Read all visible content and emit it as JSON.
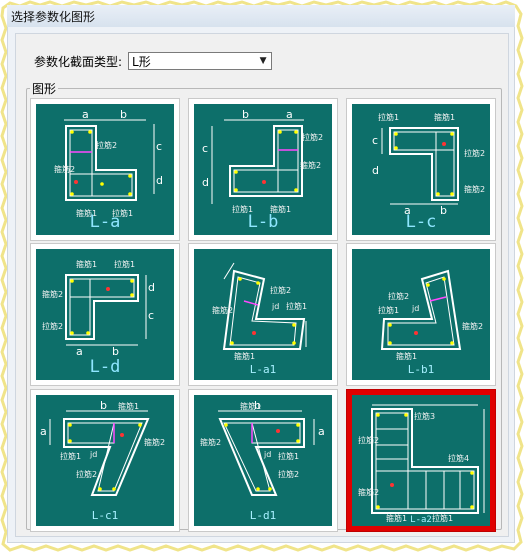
{
  "window": {
    "title": "选择参数化图形"
  },
  "section": {
    "type_label": "参数化截面类型:",
    "type_value": "L形",
    "group_label": "图形"
  },
  "tiles": [
    {
      "caption": "L-a",
      "labels": [
        "a",
        "b",
        "c",
        "d",
        "拉筋2",
        "拉筋1",
        "箍筋2",
        "箍筋1"
      ]
    },
    {
      "caption": "L-b",
      "labels": [
        "b",
        "a",
        "c",
        "d",
        "拉筋2",
        "箍筋2",
        "拉筋1",
        "箍筋1"
      ]
    },
    {
      "caption": "L-c",
      "labels": [
        "拉筋1",
        "箍筋1",
        "拉筋2",
        "箍筋2",
        "a",
        "b",
        "c",
        "d"
      ]
    },
    {
      "caption": "L-d",
      "labels": [
        "箍筋1",
        "拉筋1",
        "箍筋2",
        "拉筋2",
        "a",
        "b",
        "c",
        "d"
      ]
    },
    {
      "caption": "L-a1",
      "labels": [
        "拉筋2",
        "拉筋1",
        "箍筋2",
        "箍筋1",
        "jd"
      ]
    },
    {
      "caption": "L-b1",
      "labels": [
        "拉筋2",
        "拉筋1",
        "箍筋2",
        "箍筋1",
        "jd"
      ]
    },
    {
      "caption": "L-c1",
      "labels": [
        "箍筋1",
        "箍筋2",
        "拉筋1",
        "jd",
        "拉筋2",
        "b",
        "a"
      ]
    },
    {
      "caption": "L-d1",
      "labels": [
        "箍筋1",
        "箍筋2",
        "拉筋1",
        "jd",
        "拉筋2",
        "b",
        "a"
      ]
    },
    {
      "caption": "L-a2",
      "labels": [
        "拉筋2",
        "拉筋3",
        "拉筋4",
        "箍筋2",
        "箍筋1",
        "拉筋1"
      ]
    }
  ],
  "colors": {
    "tile_bg": "#0d6f6a",
    "selected": "#e00000",
    "line": "#ffffff",
    "tie": "#ff48ff",
    "bar": "#ffff00"
  }
}
